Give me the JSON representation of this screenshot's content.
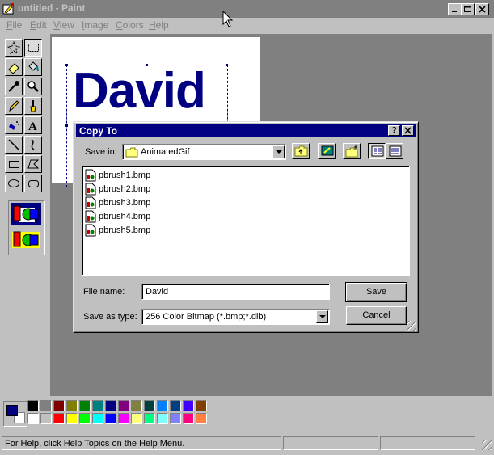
{
  "window": {
    "title": "untitled - Paint"
  },
  "menu": {
    "items": [
      {
        "label": "File",
        "key": "F",
        "rest": "ile"
      },
      {
        "label": "Edit",
        "key": "E",
        "rest": "dit"
      },
      {
        "label": "View",
        "key": "V",
        "rest": "iew"
      },
      {
        "label": "Image",
        "key": "I",
        "rest": "mage"
      },
      {
        "label": "Colors",
        "key": "C",
        "rest": "olors"
      },
      {
        "label": "Help",
        "key": "H",
        "rest": "elp"
      }
    ]
  },
  "canvas": {
    "text": "David",
    "text_color": "#000080"
  },
  "dialog": {
    "title": "Copy To",
    "help_button": "?",
    "close_button": "×",
    "save_in_label": "Save in:",
    "save_in_value": "AnimatedGif",
    "files": [
      "pbrush1.bmp",
      "pbrush2.bmp",
      "pbrush3.bmp",
      "pbrush4.bmp",
      "pbrush5.bmp"
    ],
    "file_name_label": "File name:",
    "file_name_value": "David",
    "save_as_type_label": "Save as type:",
    "save_as_type_value": "256 Color Bitmap (*.bmp;*.dib)",
    "save_button": "Save",
    "cancel_button": "Cancel"
  },
  "palette": {
    "foreground": "#000080",
    "background": "#ffffff",
    "row1": [
      "#000000",
      "#808080",
      "#800000",
      "#808000",
      "#008000",
      "#008080",
      "#000080",
      "#800080",
      "#808040",
      "#004040",
      "#0080ff",
      "#004080",
      "#4000ff",
      "#804000"
    ],
    "row2": [
      "#ffffff",
      "#c0c0c0",
      "#ff0000",
      "#ffff00",
      "#00ff00",
      "#00ffff",
      "#0000ff",
      "#ff00ff",
      "#ffff80",
      "#00ff80",
      "#80ffff",
      "#8080ff",
      "#ff0080",
      "#ff8040"
    ]
  },
  "status": {
    "text": "For Help, click Help Topics on the Help Menu."
  }
}
